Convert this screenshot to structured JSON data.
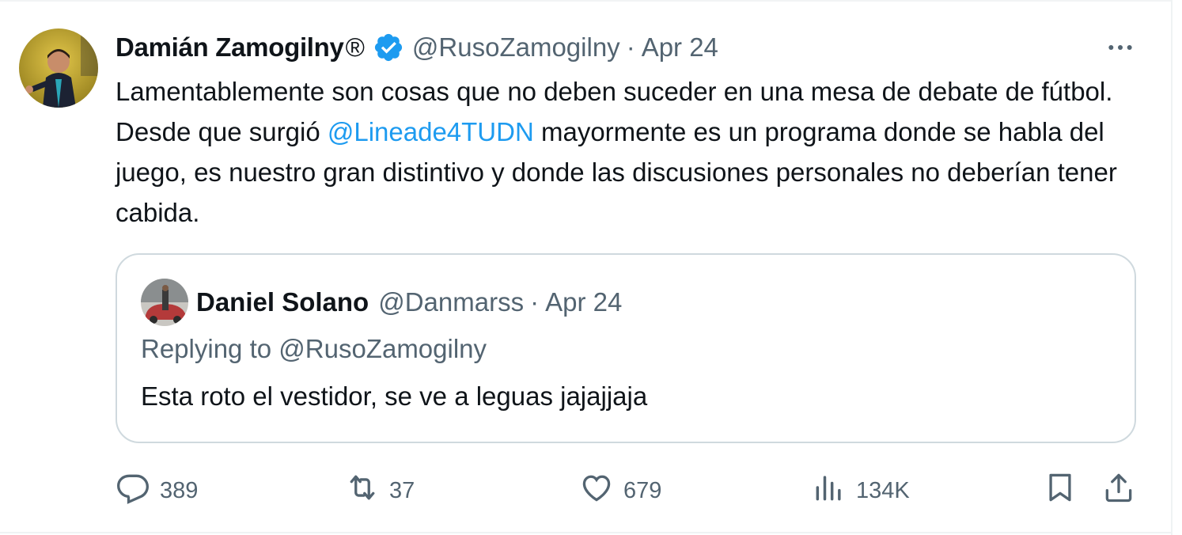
{
  "tweet": {
    "author_name": "Damián Zamogilny",
    "registered_mark": "®",
    "handle": "@RusoZamogilny",
    "separator": "·",
    "date": "Apr 24",
    "text_part1": "Lamentablemente son cosas que no deben suceder en una mesa de debate de fútbol. Desde que surgió ",
    "mention": "@Lineade4TUDN",
    "text_part2": " mayormente es un programa donde se habla del juego, es nuestro gran distintivo y donde las discusiones personales no deberían tener cabida."
  },
  "quoted_tweet": {
    "author_name": "Daniel Solano",
    "handle": "@Danmarss",
    "separator": "·",
    "date": "Apr 24",
    "replying_to": "Replying to @RusoZamogilny",
    "text": "Esta roto el vestidor, se ve a leguas jajajjaja"
  },
  "actions": {
    "replies": "389",
    "reposts": "37",
    "likes": "679",
    "views": "134K"
  },
  "icons": {
    "verified": "verified-badge-icon",
    "more": "more-icon",
    "reply": "reply-icon",
    "repost": "repost-icon",
    "like": "like-icon",
    "views": "views-icon",
    "bookmark": "bookmark-icon",
    "share": "share-icon"
  },
  "colors": {
    "text": "#0f1419",
    "secondary": "#536471",
    "link": "#1d9bf0",
    "border": "#cfd9de",
    "verified": "#1d9bf0"
  }
}
